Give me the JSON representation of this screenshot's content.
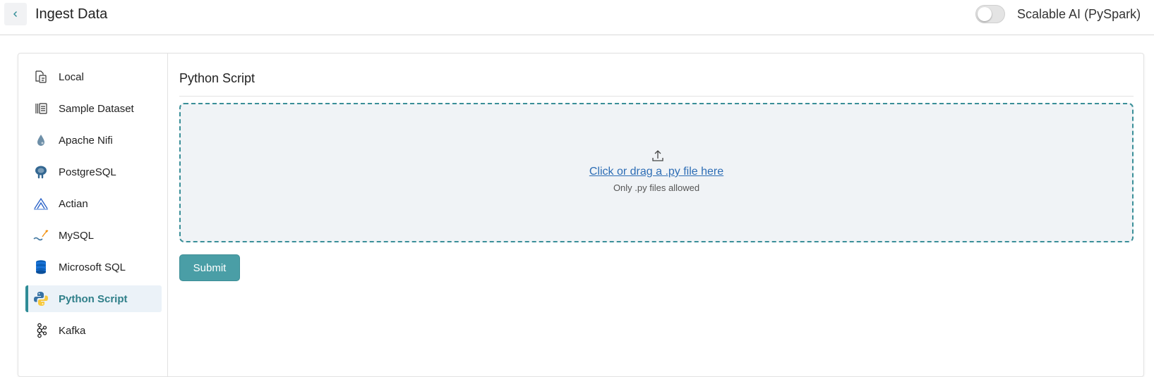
{
  "header": {
    "title": "Ingest Data",
    "back_icon": "chevron-left-icon",
    "toggle_label": "Scalable AI (PySpark)",
    "toggle_on": false
  },
  "sidebar": {
    "items": [
      {
        "label": "Local",
        "icon": "local-file-icon"
      },
      {
        "label": "Sample Dataset",
        "icon": "sample-dataset-icon"
      },
      {
        "label": "Apache Nifi",
        "icon": "apache-nifi-icon"
      },
      {
        "label": "PostgreSQL",
        "icon": "postgresql-icon"
      },
      {
        "label": "Actian",
        "icon": "actian-icon"
      },
      {
        "label": "MySQL",
        "icon": "mysql-icon"
      },
      {
        "label": "Microsoft SQL",
        "icon": "microsoft-sql-icon"
      },
      {
        "label": "Python Script",
        "icon": "python-icon",
        "active": true
      },
      {
        "label": "Kafka",
        "icon": "kafka-icon"
      }
    ]
  },
  "main": {
    "section_title": "Python Script",
    "dropzone": {
      "icon": "upload-icon",
      "link_text": "Click or drag a .py file here",
      "hint": "Only .py files allowed"
    },
    "submit_label": "Submit"
  },
  "colors": {
    "accent": "#2f8c96",
    "active_bg": "#ebf2f8",
    "link": "#2d6db5",
    "button": "#4a9ea6"
  }
}
